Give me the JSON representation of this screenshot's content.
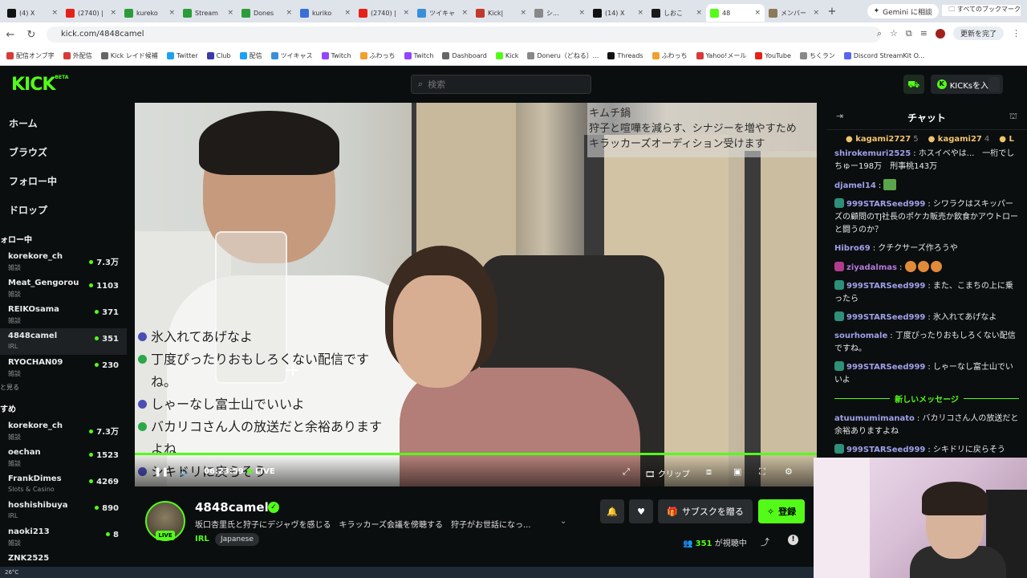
{
  "browser": {
    "tabs": [
      {
        "title": "(4) X",
        "color": "#111111"
      },
      {
        "title": "(2740) |",
        "color": "#e62117"
      },
      {
        "title": "kureko",
        "color": "#2a9d3a"
      },
      {
        "title": "Stream",
        "color": "#2a9d3a"
      },
      {
        "title": "Dones",
        "color": "#2a9d3a"
      },
      {
        "title": "kuriko",
        "color": "#3a6fd8"
      },
      {
        "title": "(2740) |",
        "color": "#e62117"
      },
      {
        "title": "ツイキャ",
        "color": "#3a8fd8"
      },
      {
        "title": "Kick|",
        "color": "#c0392b"
      },
      {
        "title": "シ...",
        "color": "#888888"
      },
      {
        "title": "(14) X",
        "color": "#111111"
      },
      {
        "title": "しおこ",
        "color": "#1a1a1a"
      },
      {
        "title": "48",
        "color": "#53fc18"
      },
      {
        "title": "メンバー",
        "color": "#8a7a5a"
      }
    ],
    "active_tab_index": 12,
    "gemini_label": "Gemini に相談",
    "url": "kick.com/4848camel",
    "update_label": "更新を完了",
    "bookmarks": [
      {
        "label": "配信オンブ字",
        "color": "#d83a3a"
      },
      {
        "label": "外配信",
        "color": "#d83a3a"
      },
      {
        "label": "Kick レイド候補",
        "color": "#666666"
      },
      {
        "label": "Twitter",
        "color": "#1da1f2"
      },
      {
        "label": "Club",
        "color": "#3a3aa8"
      },
      {
        "label": "配信",
        "color": "#1da1f2"
      },
      {
        "label": "ツイキャス",
        "color": "#3a8fd8"
      },
      {
        "label": "Twitch",
        "color": "#9146ff"
      },
      {
        "label": "ふわっち",
        "color": "#f0a030"
      },
      {
        "label": "Twitch",
        "color": "#9146ff"
      },
      {
        "label": "Dashboard",
        "color": "#666666"
      },
      {
        "label": "Kick",
        "color": "#53fc18"
      },
      {
        "label": "Doneru（どねる）...",
        "color": "#888888"
      },
      {
        "label": "Threads",
        "color": "#111111"
      },
      {
        "label": "ふわっち",
        "color": "#f0a030"
      },
      {
        "label": "Yahoo!メール",
        "color": "#d83a3a"
      },
      {
        "label": "YouTube",
        "color": "#e62117"
      },
      {
        "label": "ちくラン",
        "color": "#888888"
      },
      {
        "label": "Discord StreamKit O...",
        "color": "#5865f2"
      }
    ],
    "all_bookmarks": "すべてのブックマーク"
  },
  "header": {
    "logo": "KICK",
    "logo_beta": "BETA",
    "search_placeholder": "検索",
    "kicks_label": "KICKsを入手"
  },
  "sidebar": {
    "nav": [
      "ホーム",
      "ブラウズ",
      "フォロー中",
      "ドロップ"
    ],
    "following_title": "ォロー中",
    "following": [
      {
        "name": "korekore_ch",
        "cat": "雑談",
        "viewers": "7.3万"
      },
      {
        "name": "Meat_Gengorou",
        "cat": "雑談",
        "viewers": "1103"
      },
      {
        "name": "REIKOsama",
        "cat": "雑談",
        "viewers": "371"
      },
      {
        "name": "4848camel",
        "cat": "IRL",
        "viewers": "351"
      },
      {
        "name": "RYOCHAN09",
        "cat": "雑談",
        "viewers": "230"
      }
    ],
    "show_more": "と見る",
    "recommended_title": "すめ",
    "recommended": [
      {
        "name": "korekore_ch",
        "cat": "雑談",
        "viewers": "7.3万"
      },
      {
        "name": "oechan",
        "cat": "雑談",
        "viewers": "1523"
      },
      {
        "name": "FrankDimes",
        "cat": "Slots & Casino",
        "viewers": "4269"
      },
      {
        "name": "hoshishibuya",
        "cat": "IRL",
        "viewers": "890"
      },
      {
        "name": "naoki213",
        "cat": "雑談",
        "viewers": "8"
      },
      {
        "name": "ZNK2525",
        "cat": "",
        "viewers": ""
      }
    ]
  },
  "player": {
    "caption": [
      "キムチ鍋",
      "狩子と喧嘩を減らす、シナジーを増やすため",
      "キラッカーズオーディション受けます"
    ],
    "overlay_chat": [
      {
        "text": "氷入れてあげなよ",
        "badge": "b"
      },
      {
        "text": "丁度ぴったりおもしろくない配信です",
        "badge": "g"
      },
      {
        "text": "ね。",
        "badge": ""
      },
      {
        "text": "しゃーなし富士山でいいよ",
        "badge": "b"
      },
      {
        "text": "バカリコさん人の放送だと余裕あります",
        "badge": "g"
      },
      {
        "text": "よね",
        "badge": ""
      },
      {
        "text": "シキドリに戻らそう",
        "badge": "b"
      }
    ],
    "time": "06:23:59",
    "live_label": "LIVE",
    "clip_label": "クリップ"
  },
  "channel": {
    "name": "4848camel",
    "live_badge": "LIVE",
    "stream_title": "坂口杏里氏と狩子にデジャヴを感じる　キラッカーズ会議を傍聴する　狩子がお世話になっ...",
    "category": "IRL",
    "tag": "Japanese",
    "gift_label": "サブスクを贈る",
    "follow_label": "登録",
    "viewers": "351",
    "viewers_suffix": "が視聴中"
  },
  "chat": {
    "title": "チャット",
    "leaders": [
      {
        "name": "kagami2727",
        "count": "5"
      },
      {
        "name": "kagami27",
        "count": "4"
      },
      {
        "name": "L",
        "count": ""
      }
    ],
    "messages": [
      {
        "user": "shirokemuri2525",
        "color": "#9fa0e8",
        "badge": "",
        "text": "ホスイベやは...　一桁でしちゅー198万　刑事桃143万"
      },
      {
        "user": "djamel14",
        "color": "#9fa0e8",
        "badge": "",
        "text": ""
      },
      {
        "user": "999STARSeed999",
        "color": "#9fa0e8",
        "badge": "t",
        "text": "シワラクはスキッパーズの顧問のTJ社長のポケカ販売か飲食かアウトローと闘うのか？"
      },
      {
        "user": "Hibro69",
        "color": "#9fa0e8",
        "badge": "",
        "text": "クチクサーズ作ろうや"
      },
      {
        "user": "ziyadalmas",
        "color": "#b47ad8",
        "badge": "p",
        "text": ""
      },
      {
        "user": "999STARSeed999",
        "color": "#9fa0e8",
        "badge": "t",
        "text": "また、こまちの上に乗ったら"
      },
      {
        "user": "999STARSeed999",
        "color": "#9fa0e8",
        "badge": "t",
        "text": "氷入れてあげなよ"
      },
      {
        "user": "sourhomale",
        "color": "#9fa0e8",
        "badge": "",
        "text": "丁度ぴったりおもしろくない配信ですね。"
      },
      {
        "user": "999STARSeed999",
        "color": "#9fa0e8",
        "badge": "t",
        "text": "しゃーなし富士山でいいよ"
      }
    ],
    "new_messages_label": "新しいメッセージ",
    "new_messages": [
      {
        "user": "atuumumimanato",
        "color": "#9fa0e8",
        "badge": "",
        "text": "バカリコさん人の放送だと余裕ありますよね"
      },
      {
        "user": "999STARSeed999",
        "color": "#9fa0e8",
        "badge": "t",
        "text": "シキドリに戻らそう"
      }
    ]
  },
  "taskbar": {
    "temp": "26°C"
  },
  "colors": {
    "kick_green": "#53fc18",
    "bg": "#0b0e0f"
  }
}
